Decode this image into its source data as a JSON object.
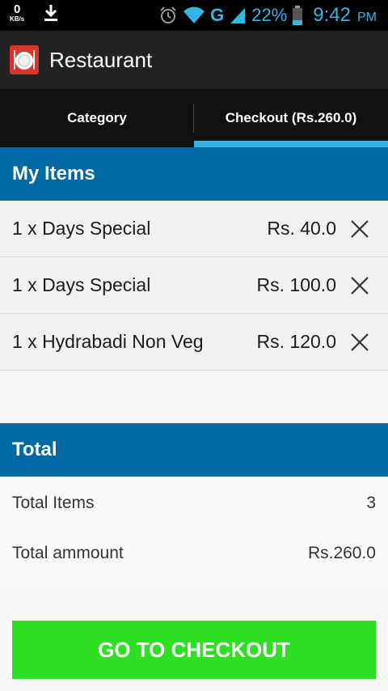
{
  "status_bar": {
    "speed_value": "0",
    "speed_unit": "KB/s",
    "network": "G",
    "battery_percent": "22%",
    "time": "9:42",
    "ampm": "PM"
  },
  "app": {
    "title": "Restaurant"
  },
  "tabs": [
    {
      "label": "Category",
      "active": false
    },
    {
      "label": "Checkout (Rs.260.0)",
      "active": true
    }
  ],
  "my_items": {
    "header": "My Items",
    "items": [
      {
        "name": "1 x Days Special",
        "price": "Rs. 40.0"
      },
      {
        "name": "1 x Days Special",
        "price": "Rs. 100.0"
      },
      {
        "name": "1 x Hydrabadi Non Veg",
        "price": "Rs. 120.0"
      }
    ]
  },
  "total": {
    "header": "Total",
    "items_label": "Total Items",
    "items_value": "3",
    "amount_label": "Total ammount",
    "amount_value": "Rs.260.0"
  },
  "checkout_button": "GO TO CHECKOUT",
  "colors": {
    "accent": "#33b5e5",
    "section_header": "#0068a3",
    "checkout_button": "#2ee021"
  }
}
